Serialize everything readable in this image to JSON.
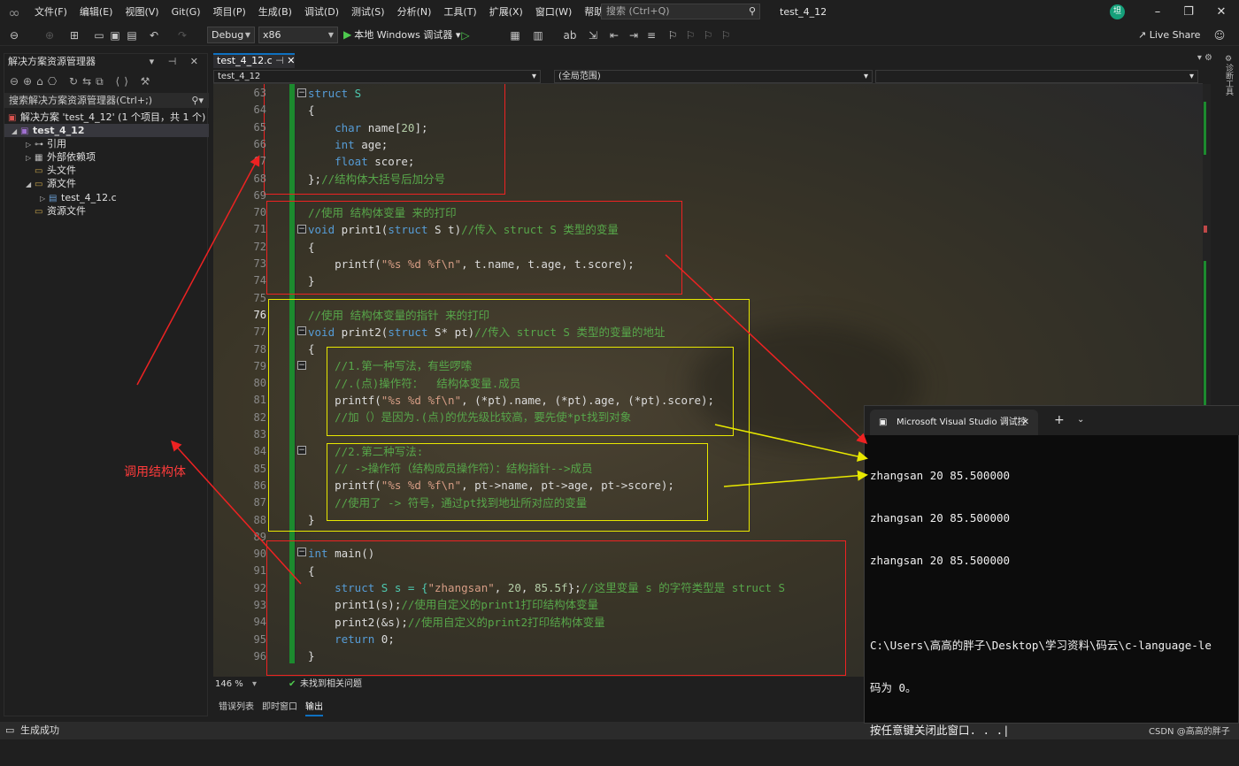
{
  "menu": [
    "文件(F)",
    "编辑(E)",
    "视图(V)",
    "Git(G)",
    "项目(P)",
    "生成(B)",
    "调试(D)",
    "测试(S)",
    "分析(N)",
    "工具(T)",
    "扩展(X)",
    "窗口(W)",
    "帮助(H)"
  ],
  "search_placeholder": "搜索 (Ctrl+Q)",
  "window_title": "test_4_12",
  "avatar_text": "坦",
  "toolbar": {
    "config": "Debug",
    "platform": "x86",
    "run_label": "本地 Windows 调试器",
    "live_share": "Live Share"
  },
  "solution_explorer": {
    "title": "解决方案资源管理器",
    "search": "搜索解决方案资源管理器(Ctrl+;)",
    "tree": [
      {
        "label": "解决方案 'test_4_12' (1 个项目，共 1 个)",
        "icon": "solution-icon"
      },
      {
        "label": "test_4_12",
        "icon": "project-icon"
      },
      {
        "label": "引用",
        "icon": "references-icon"
      },
      {
        "label": "外部依赖项",
        "icon": "external-deps-icon"
      },
      {
        "label": "头文件",
        "icon": "folder-icon"
      },
      {
        "label": "源文件",
        "icon": "folder-icon"
      },
      {
        "label": "test_4_12.c",
        "icon": "c-file-icon"
      },
      {
        "label": "资源文件",
        "icon": "folder-icon"
      }
    ]
  },
  "annotation_callout": "调用结构体",
  "editor": {
    "tab_label": "test_4_12.c",
    "nav_project": "test_4_12",
    "nav_scope": "(全局范围)",
    "current_line": "76",
    "line_numbers": [
      "63",
      "64",
      "65",
      "66",
      "67",
      "68",
      "69",
      "70",
      "71",
      "72",
      "73",
      "74",
      "75",
      "76",
      "77",
      "78",
      "79",
      "80",
      "81",
      "82",
      "83",
      "84",
      "85",
      "86",
      "87",
      "88",
      "89",
      "90",
      "91",
      "92",
      "93",
      "94",
      "95",
      "96"
    ],
    "zoom": "146 %",
    "issues": "未找到相关问题"
  },
  "code": {
    "l63a": "struct",
    "l63b": " S",
    "l64": "{",
    "l65a": "    char",
    "l65b": " name[",
    "l65c": "20",
    "l65d": "];",
    "l66a": "    int",
    "l66b": " age;",
    "l67a": "    float",
    "l67b": " score;",
    "l68a": "};",
    "l68b": "//结构体大括号后加分号",
    "l70": "//使用 结构体变量 来的打印",
    "l71a": "void",
    "l71b": " print1(",
    "l71c": "struct",
    "l71d": " S t)",
    "l71e": "//传入 struct S 类型的变量",
    "l72": "{",
    "l73a": "    printf(",
    "l73b": "\"%s %d %f\\n\"",
    "l73c": ", t.name, t.age, t.score);",
    "l74": "}",
    "l76": "//使用 结构体变量的指针 来的打印",
    "l77a": "void",
    "l77b": " print2(",
    "l77c": "struct",
    "l77d": " S* pt)",
    "l77e": "//传入 struct S 类型的变量的地址",
    "l78": "{",
    "l79": "    //1.第一种写法，有些啰嗦",
    "l80": "    //.(点)操作符：  结构体变量.成员",
    "l81a": "    printf(",
    "l81b": "\"%s %d %f\\n\"",
    "l81c": ", (*pt).name, (*pt).age, (*pt).score);",
    "l82": "    //加（）是因为.(点)的优先级比较高，要先使*pt找到对象",
    "l84": "    //2.第二种写法:",
    "l85": "    // ->操作符（结构成员操作符）：结构指针-->成员",
    "l86a": "    printf(",
    "l86b": "\"%s %d %f\\n\"",
    "l86c": ", pt->name, pt->age, pt->score);",
    "l87": "    //使用了 -> 符号，通过pt找到地址所对应的变量",
    "l88": "}",
    "l90a": "int",
    "l90b": " main()",
    "l91": "{",
    "l92a": "    struct",
    "l92b": " S s = {",
    "l92c": "\"zhangsan\"",
    "l92d": ", ",
    "l92e": "20",
    "l92f": ", ",
    "l92g": "85.5f",
    "l92h": "};",
    "l92i": "//这里变量 s 的字符类型是 struct S",
    "l93a": "    print1(s);",
    "l93b": "//使用自定义的print1打印结构体变量",
    "l94a": "    print2(&s);",
    "l94b": "//使用自定义的print2打印结构体变量",
    "l95a": "    return",
    "l95b": " 0;",
    "l96": "}"
  },
  "bottom_tabs": [
    "错误列表",
    "即时窗口",
    "输出"
  ],
  "status_text": "生成成功",
  "console": {
    "tab_title": "Microsoft Visual Studio 调试控",
    "lines": [
      "zhangsan 20 85.500000",
      "zhangsan 20 85.500000",
      "zhangsan 20 85.500000",
      "",
      "C:\\Users\\高高的胖子\\Desktop\\学习资料\\码云\\c-language-le",
      "码为 0。",
      "按任意键关闭此窗口. . .|"
    ]
  },
  "watermark": "CSDN @高高的胖子",
  "colors": {
    "annotation_red": "#e22222",
    "annotation_yellow": "#e8e800",
    "accent_blue": "#0e70c0"
  }
}
